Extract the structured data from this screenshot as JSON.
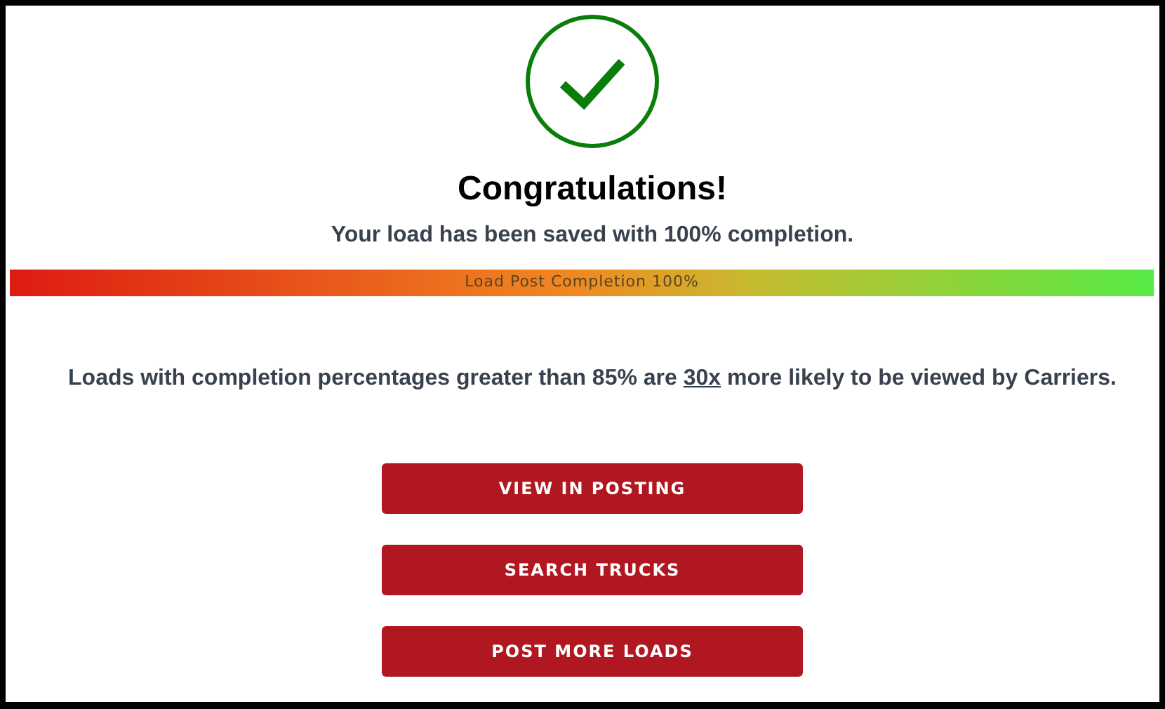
{
  "heading": "Congratulations!",
  "subheading": "Your load has been saved with 100% completion.",
  "completion_bar": {
    "label": "Load Post Completion 100%"
  },
  "note": {
    "before": "Loads with completion percentages greater than 85% are ",
    "highlight": "30x",
    "after": " more likely to be viewed by Carriers."
  },
  "buttons": [
    "VIEW IN POSTING",
    "SEARCH TRUCKS",
    "POST MORE LOADS"
  ]
}
